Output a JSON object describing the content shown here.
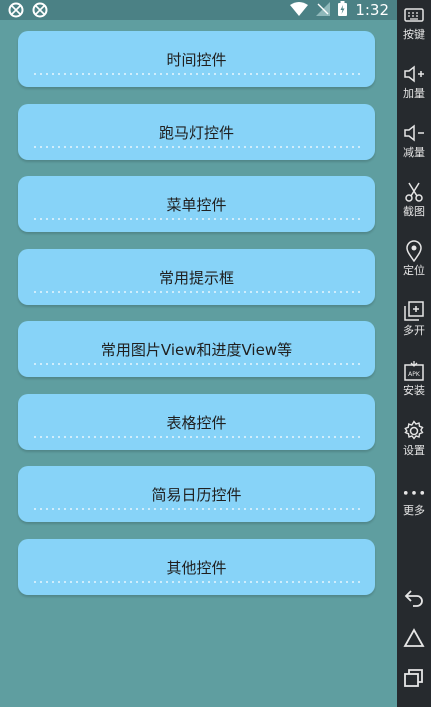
{
  "status_bar": {
    "time": "1:32"
  },
  "menu": {
    "items": [
      {
        "label": "时间控件"
      },
      {
        "label": "跑马灯控件"
      },
      {
        "label": "菜单控件"
      },
      {
        "label": "常用提示框"
      },
      {
        "label": "常用图片View和进度View等"
      },
      {
        "label": "表格控件"
      },
      {
        "label": "简易日历控件"
      },
      {
        "label": "其他控件"
      }
    ]
  },
  "emulator_sidebar": {
    "items": [
      {
        "label": "按键",
        "icon": "keyboard-icon"
      },
      {
        "label": "加量",
        "icon": "volume-up-icon"
      },
      {
        "label": "减量",
        "icon": "volume-down-icon"
      },
      {
        "label": "截图",
        "icon": "scissors-icon"
      },
      {
        "label": "定位",
        "icon": "location-pin-icon"
      },
      {
        "label": "多开",
        "icon": "multi-window-icon"
      },
      {
        "label": "安装",
        "icon": "apk-install-icon"
      },
      {
        "label": "设置",
        "icon": "gear-icon"
      },
      {
        "label": "更多",
        "icon": "more-dots-icon"
      }
    ],
    "nav": [
      "back-icon",
      "home-icon",
      "recents-icon"
    ]
  },
  "colors": {
    "background": "#5f9ea0",
    "button": "#87d3f8",
    "sidebar": "#262a2e"
  }
}
